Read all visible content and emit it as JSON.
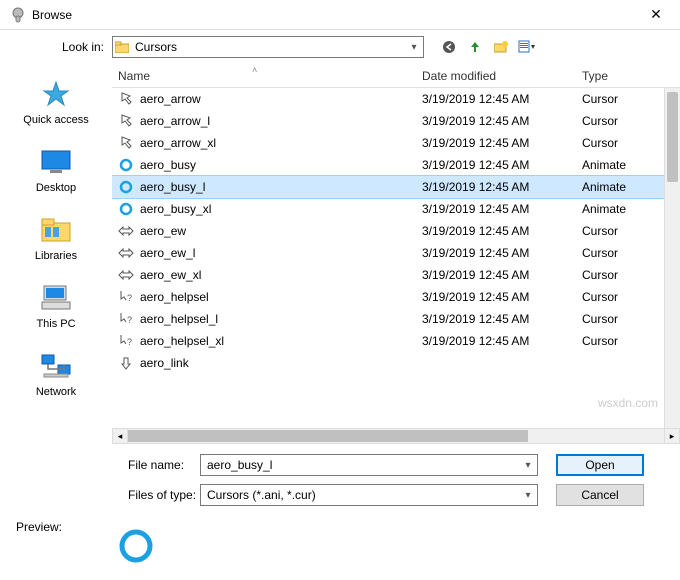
{
  "window": {
    "title": "Browse"
  },
  "lookin": {
    "label": "Look in:",
    "folder_name": "Cursors"
  },
  "columns": {
    "name": "Name",
    "date": "Date modified",
    "type": "Type"
  },
  "files": [
    {
      "name": "aero_arrow",
      "date": "3/19/2019 12:45 AM",
      "type": "Cursor",
      "icon": "arrow"
    },
    {
      "name": "aero_arrow_l",
      "date": "3/19/2019 12:45 AM",
      "type": "Cursor",
      "icon": "arrow"
    },
    {
      "name": "aero_arrow_xl",
      "date": "3/19/2019 12:45 AM",
      "type": "Cursor",
      "icon": "arrow"
    },
    {
      "name": "aero_busy",
      "date": "3/19/2019 12:45 AM",
      "type": "Animate",
      "icon": "busy"
    },
    {
      "name": "aero_busy_l",
      "date": "3/19/2019 12:45 AM",
      "type": "Animate",
      "icon": "busy"
    },
    {
      "name": "aero_busy_xl",
      "date": "3/19/2019 12:45 AM",
      "type": "Animate",
      "icon": "busy"
    },
    {
      "name": "aero_ew",
      "date": "3/19/2019 12:45 AM",
      "type": "Cursor",
      "icon": "ew"
    },
    {
      "name": "aero_ew_l",
      "date": "3/19/2019 12:45 AM",
      "type": "Cursor",
      "icon": "ew"
    },
    {
      "name": "aero_ew_xl",
      "date": "3/19/2019 12:45 AM",
      "type": "Cursor",
      "icon": "ew"
    },
    {
      "name": "aero_helpsel",
      "date": "3/19/2019 12:45 AM",
      "type": "Cursor",
      "icon": "help"
    },
    {
      "name": "aero_helpsel_l",
      "date": "3/19/2019 12:45 AM",
      "type": "Cursor",
      "icon": "help"
    },
    {
      "name": "aero_helpsel_xl",
      "date": "3/19/2019 12:45 AM",
      "type": "Cursor",
      "icon": "help"
    },
    {
      "name": "aero_link",
      "date": "",
      "type": "",
      "icon": "link"
    }
  ],
  "selected_index": 4,
  "sidebar": {
    "items": [
      {
        "label": "Quick access"
      },
      {
        "label": "Desktop"
      },
      {
        "label": "Libraries"
      },
      {
        "label": "This PC"
      },
      {
        "label": "Network"
      }
    ]
  },
  "form": {
    "filename_label": "File name:",
    "filename_value": "aero_busy_l",
    "filetype_label": "Files of type:",
    "filetype_value": "Cursors (*.ani, *.cur)"
  },
  "buttons": {
    "open": "Open",
    "cancel": "Cancel"
  },
  "preview": {
    "label": "Preview:"
  }
}
